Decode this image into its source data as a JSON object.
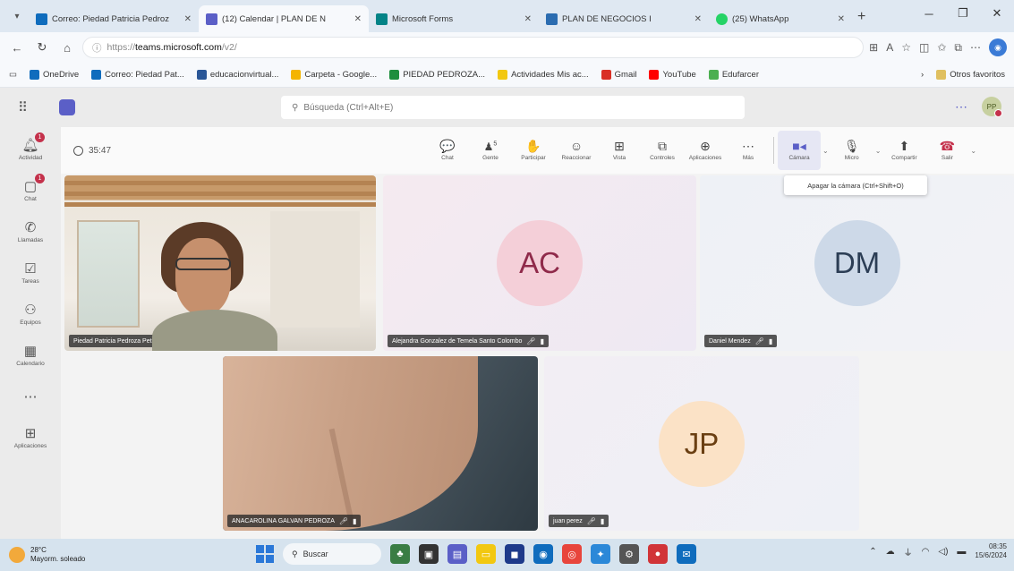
{
  "browser": {
    "tabs": [
      {
        "title": "Correo: Piedad Patricia Pedroz",
        "icon_color": "#0f6cbd",
        "active": false
      },
      {
        "title": "(12) Calendar | PLAN DE N",
        "icon_color": "#5b5fc7",
        "active": true
      },
      {
        "title": "Microsoft Forms",
        "icon_color": "#038387",
        "active": false
      },
      {
        "title": "PLAN DE NEGOCIOS I",
        "icon_color": "#2b6cb0",
        "active": false
      },
      {
        "title": "(25) WhatsApp",
        "icon_color": "#25d366",
        "active": false
      }
    ],
    "url_prefix": "https://",
    "url_host": "teams.microsoft.com",
    "url_path": "/v2/",
    "bookmarks": [
      {
        "label": "OneDrive",
        "color": "#0f6cbd"
      },
      {
        "label": "Correo: Piedad Pat...",
        "color": "#0f6cbd"
      },
      {
        "label": "educacionvirtual...",
        "color": "#2b5797"
      },
      {
        "label": "Carpeta - Google...",
        "color": "#f4b400"
      },
      {
        "label": "PIEDAD PEDROZA...",
        "color": "#1e8e3e"
      },
      {
        "label": "Actividades Mis ac...",
        "color": "#f2c811"
      },
      {
        "label": "Gmail",
        "color": "#d93025"
      },
      {
        "label": "YouTube",
        "color": "#ff0000"
      },
      {
        "label": "Edufarcer",
        "color": "#4caf50"
      }
    ],
    "other_favorites": "Otros favoritos"
  },
  "teams": {
    "search_placeholder": "Búsqueda (Ctrl+Alt+E)",
    "user_initials": "PP",
    "rail": [
      {
        "label": "Actividad",
        "icon": "bell",
        "badge": "1"
      },
      {
        "label": "Chat",
        "icon": "chat",
        "badge": "1"
      },
      {
        "label": "Llamadas",
        "icon": "phone",
        "badge": ""
      },
      {
        "label": "Tareas",
        "icon": "tasks",
        "badge": ""
      },
      {
        "label": "Equipos",
        "icon": "teams",
        "badge": ""
      },
      {
        "label": "Calendario",
        "icon": "calendar",
        "badge": ""
      },
      {
        "label": "",
        "icon": "more",
        "badge": ""
      },
      {
        "label": "Aplicaciones",
        "icon": "apps",
        "badge": ""
      }
    ]
  },
  "meeting": {
    "timer": "35:47",
    "participant_count": "5",
    "controls": [
      {
        "label": "Chat",
        "glyph": "💬"
      },
      {
        "label": "Gente",
        "glyph": "👥"
      },
      {
        "label": "Participar",
        "glyph": "✋"
      },
      {
        "label": "Reaccionar",
        "glyph": "☺"
      },
      {
        "label": "Vista",
        "glyph": "⊞"
      },
      {
        "label": "Controles",
        "glyph": "⧉"
      },
      {
        "label": "Aplicaciones",
        "glyph": "⊕"
      },
      {
        "label": "Más",
        "glyph": "⋯"
      }
    ],
    "camera_label": "Cámara",
    "mic_label": "Micro",
    "share_label": "Compartir",
    "leave_label": "Salir",
    "tooltip": "Apagar la cámara (Ctrl+Shift+O)",
    "participants": [
      {
        "name": "Piedad Patricia Pedroza Petro",
        "initials": "",
        "video": true
      },
      {
        "name": "Alejandra Gonzalez de Temela Santo Colombo",
        "initials": "AC",
        "avatar_bg": "#f4cfd8",
        "avatar_fg": "#8f2a4a",
        "video": false
      },
      {
        "name": "Daniel Mendez",
        "initials": "DM",
        "avatar_bg": "#cdd9e8",
        "avatar_fg": "#2c3e55",
        "video": false
      },
      {
        "name": "ANACAROLINA GALVAN PEDROZA",
        "initials": "",
        "video": true
      },
      {
        "name": "juan perez",
        "initials": "JP",
        "avatar_bg": "#fbe2c6",
        "avatar_fg": "#6a3f12",
        "video": false
      }
    ]
  },
  "taskbar": {
    "temperature": "28°C",
    "weather": "Mayorm. soleado",
    "search_label": "Buscar",
    "time": "08:35",
    "date": "15/6/2024"
  }
}
